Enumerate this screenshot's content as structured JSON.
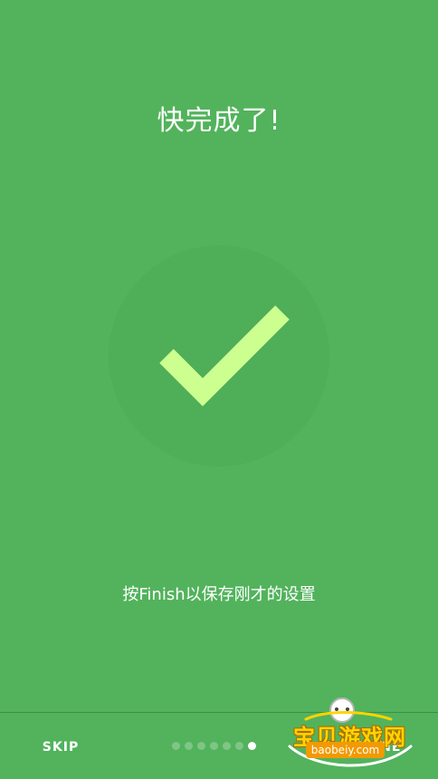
{
  "intro": {
    "title": "快完成了!",
    "subtitle": "按Finish以保存刚才的设置"
  },
  "nav": {
    "skip_label": "SKIP",
    "done_label": "DONE",
    "page_indicator": {
      "total": 7,
      "active_index": 6
    }
  },
  "watermark": {
    "site_name": "宝贝游戏网",
    "site_url": "baobeiy.com"
  },
  "colors": {
    "background": "#52b35c",
    "circle": "#4fae58",
    "checkmark": "#ccff90",
    "dot_inactive": "#7fc586",
    "dot_active": "#ffffff"
  }
}
